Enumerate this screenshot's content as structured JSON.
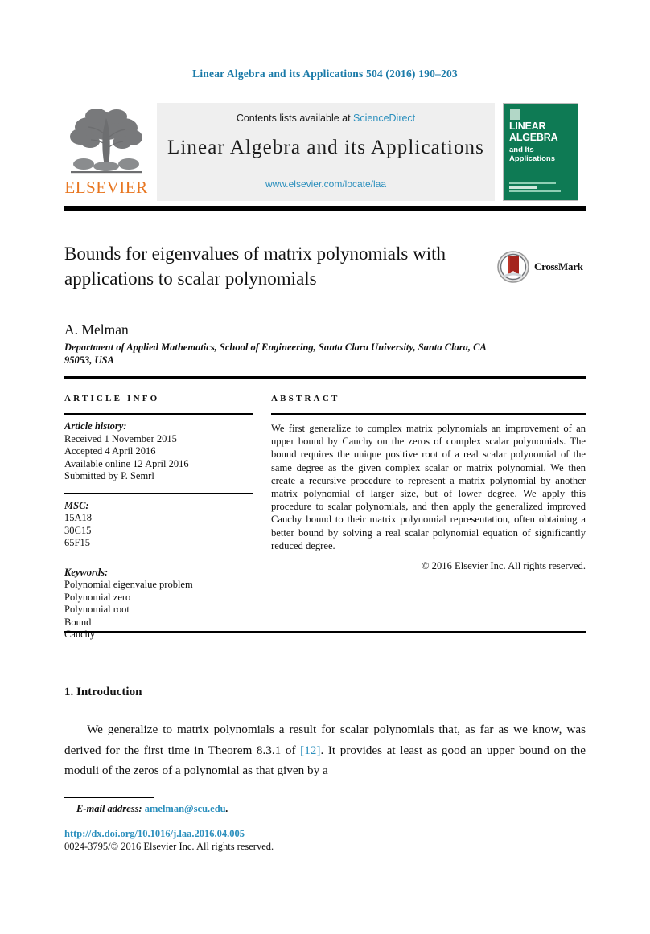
{
  "running_head": "Linear Algebra and its Applications 504 (2016) 190–203",
  "masthead": {
    "publisher_name": "ELSEVIER",
    "contents_prefix": "Contents lists available at ",
    "contents_link": "ScienceDirect",
    "journal_title": "Linear Algebra and its Applications",
    "journal_url": "www.elsevier.com/locate/laa",
    "cover": {
      "title": "LINEAR ALGEBRA",
      "subtitle": "and Its Applications",
      "background_color": "#0e7a54"
    }
  },
  "article": {
    "title": "Bounds for eigenvalues of matrix polynomials with applications to scalar polynomials",
    "crossmark_label": "CrossMark",
    "author": "A. Melman",
    "affiliation": "Department of Applied Mathematics, School of Engineering, Santa Clara University, Santa Clara, CA 95053, USA"
  },
  "info": {
    "heading": "ARTICLE INFO",
    "history_label": "Article history:",
    "history": [
      "Received 1 November 2015",
      "Accepted 4 April 2016",
      "Available online 12 April 2016",
      "Submitted by P. Semrl"
    ],
    "msc_label": "MSC:",
    "msc": [
      "15A18",
      "30C15",
      "65F15"
    ],
    "keywords_label": "Keywords:",
    "keywords": [
      "Polynomial eigenvalue problem",
      "Polynomial zero",
      "Polynomial root",
      "Bound",
      "Cauchy"
    ]
  },
  "abstract": {
    "heading": "ABSTRACT",
    "text": "We first generalize to complex matrix polynomials an improvement of an upper bound by Cauchy on the zeros of complex scalar polynomials. The bound requires the unique positive root of a real scalar polynomial of the same degree as the given complex scalar or matrix polynomial. We then create a recursive procedure to represent a matrix polynomial by another matrix polynomial of larger size, but of lower degree. We apply this procedure to scalar polynomials, and then apply the generalized improved Cauchy bound to their matrix polynomial representation, often obtaining a better bound by solving a real scalar polynomial equation of significantly reduced degree.",
    "copyright": "© 2016 Elsevier Inc. All rights reserved."
  },
  "body": {
    "section_heading": "1. Introduction",
    "paragraph_part1": "We generalize to matrix polynomials a result for scalar polynomials that, as far as we know, was derived for the first time in Theorem 8.3.1 of ",
    "citation": "[12]",
    "paragraph_part2": ". It provides at least as good an upper bound on the moduli of the zeros of a polynomial as that given by a"
  },
  "footer": {
    "email_label": "E-mail address:",
    "email": "amelman@scu.edu",
    "email_suffix": ".",
    "doi": "http://dx.doi.org/10.1016/j.laa.2016.04.005",
    "issn_line": "0024-3795/© 2016 Elsevier Inc. All rights reserved."
  },
  "colors": {
    "link": "#2b8fbd",
    "running_head": "#1a7aa8",
    "elsevier_orange": "#e87722",
    "cover_green": "#0e7a54"
  }
}
